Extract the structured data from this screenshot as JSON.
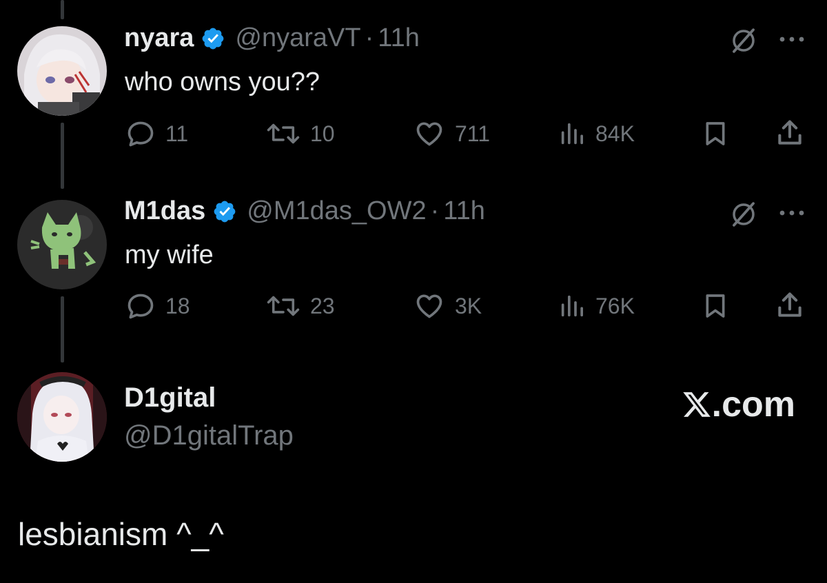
{
  "tweets": [
    {
      "display_name": "nyara",
      "handle": "@nyaraVT",
      "separator": "·",
      "time": "11h",
      "text": "who owns you??",
      "replies": "11",
      "reposts": "10",
      "likes": "711",
      "views": "84K",
      "verified": true
    },
    {
      "display_name": "M1das",
      "handle": "@M1das_OW2",
      "separator": "·",
      "time": "11h",
      "text": "my wife",
      "replies": "18",
      "reposts": "23",
      "likes": "3K",
      "views": "76K",
      "verified": true
    }
  ],
  "author": {
    "display_name": "D1gital",
    "handle": "@D1gitalTrap"
  },
  "brand": {
    "logo_text": ".com",
    "logo_icon": "x-logo-icon"
  },
  "reply": {
    "text": "lesbianism ^_^"
  },
  "colors": {
    "background": "#000000",
    "text_primary": "#e7e9ea",
    "text_secondary": "#71767b",
    "verified_blue": "#1d9bf0",
    "thread_line": "#333639"
  }
}
